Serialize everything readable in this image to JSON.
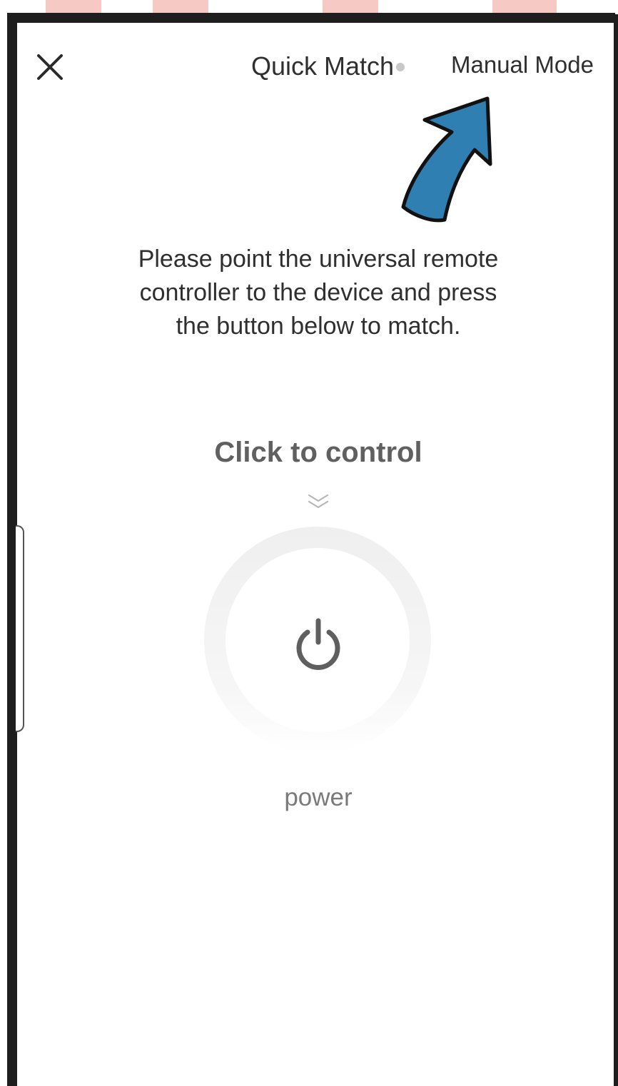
{
  "header": {
    "close_icon": "close-icon",
    "quick_match_label": "Quick Match",
    "manual_mode_label": "Manual Mode"
  },
  "main": {
    "instruction_line1": "Please point the universal remote",
    "instruction_line2": "controller to the device and press",
    "instruction_line3": "the button below to match.",
    "control_title": "Click to control",
    "power_label": "power"
  },
  "icons": {
    "close": "close-icon",
    "chevrons": "double-chevron-down-icon",
    "power": "power-icon",
    "annotation": "arrow-pointer-icon"
  },
  "colors": {
    "text_primary": "#2f2f2f",
    "text_secondary": "#606060",
    "text_muted": "#7a7a7a",
    "annotation_arrow": "#2f7fb3",
    "frame": "#1e1e1e",
    "watermark": "#f7c9c4"
  }
}
